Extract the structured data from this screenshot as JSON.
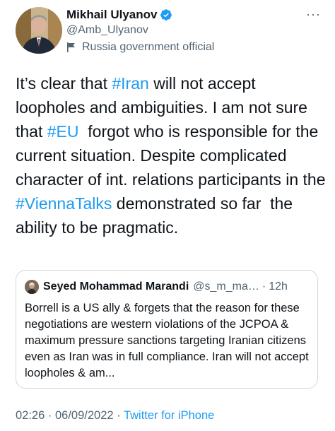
{
  "author": {
    "name": "Mikhail Ulyanov",
    "handle": "@Amb_Ulyanov",
    "label": "Russia government official",
    "more": "···"
  },
  "tweet": {
    "parts": [
      {
        "text": "It’s clear that "
      },
      {
        "text": "#Iran",
        "hashtag": true
      },
      {
        "text": " will not accept loopholes and ambiguities. I am not sure that "
      },
      {
        "text": "#EU",
        "hashtag": true
      },
      {
        "text": "  forgot who is responsible for the current situation. Despite complicated character of int. relations participants in the "
      },
      {
        "text": "#ViennaTalks",
        "hashtag": true
      },
      {
        "text": " demonstrated so far  the ability to be pragmatic."
      }
    ]
  },
  "quoted": {
    "name": "Seyed Mohammad Marandi",
    "handle": "@s_m_ma…",
    "dot": "·",
    "time": "12h",
    "text": "Borrell is a US ally & forgets that the reason for these negotiations are western violations of the JCPOA & maximum pressure sanctions targeting Iranian citizens even as Iran was in full compliance. Iran will not accept loopholes & am..."
  },
  "meta": {
    "time": "02:26",
    "sep1": " · ",
    "date": "06/09/2022",
    "sep2": " · ",
    "source": "Twitter for iPhone"
  },
  "colors": {
    "link": "#1d9bf0",
    "secondary": "#536471",
    "text": "#0f1419",
    "border": "#cfd9de"
  }
}
